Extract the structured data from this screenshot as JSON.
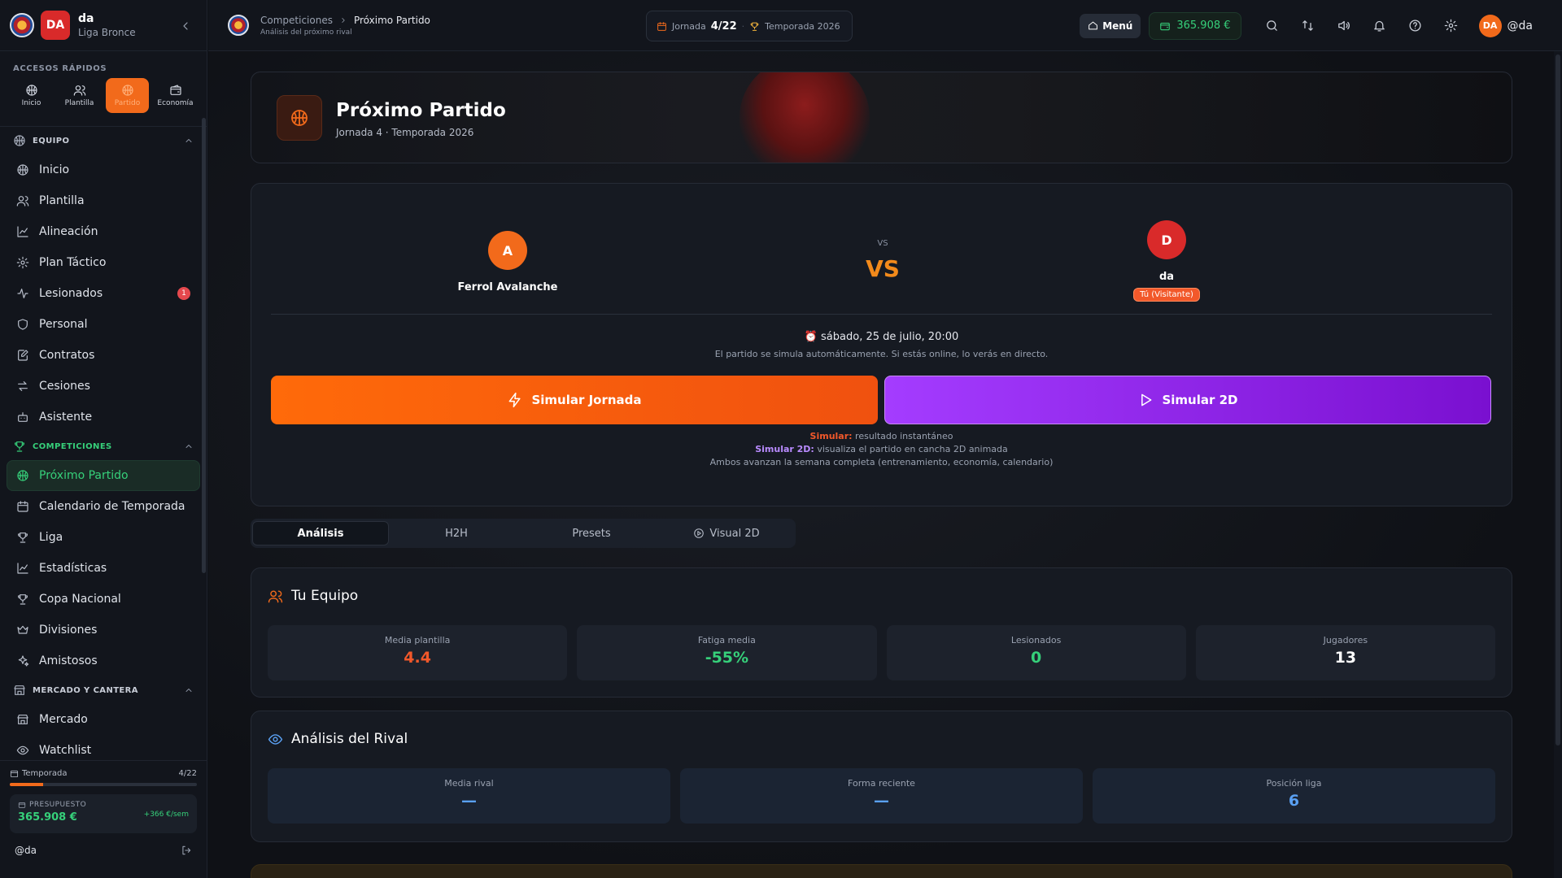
{
  "sidebar": {
    "club_badge": "DA",
    "club_name": "da",
    "club_league": "Liga Bronce",
    "quick_title": "Accesos rápidos",
    "quick": [
      {
        "label": "Inicio",
        "icon": "basketball-icon"
      },
      {
        "label": "Plantilla",
        "icon": "users-icon"
      },
      {
        "label": "Partido",
        "icon": "basketball-icon",
        "active": true
      },
      {
        "label": "Economía",
        "icon": "wallet-icon"
      }
    ],
    "groups": [
      {
        "title": "Equipo",
        "items": [
          "Inicio",
          "Plantilla",
          "Alineación",
          "Plan Táctico",
          "Lesionados",
          "Personal",
          "Contratos",
          "Cesiones",
          "Asistente"
        ],
        "badge": "1"
      },
      {
        "title": "Competiciones",
        "items": [
          "Próximo Partido",
          "Calendario de Temporada",
          "Liga",
          "Estadísticas",
          "Copa Nacional",
          "Divisiones",
          "Amistosos"
        ]
      },
      {
        "title": "Mercado y cantera",
        "items": [
          "Mercado",
          "Watchlist"
        ]
      }
    ],
    "season_label": "Temporada",
    "season_progress": "4/22",
    "season_fraction": 0.18,
    "budget_label": "Presupuesto",
    "budget_value": "365.908 €",
    "budget_delta": "+366 €/sem",
    "user": "@da"
  },
  "topbar": {
    "crumb_parent": "Competiciones",
    "crumb_current": "Próximo Partido",
    "crumb_sub": "Análisis del próximo rival",
    "jornada_label": "Jornada",
    "jornada_value": "4/22",
    "temporada": "Temporada 2026",
    "menu_label": "Menú",
    "money": "365.908 €",
    "avatar": "DA",
    "username": "@da"
  },
  "hero": {
    "title": "Próximo Partido",
    "subtitle": "Jornada 4 · Temporada 2026"
  },
  "match": {
    "home": {
      "initial": "A",
      "name": "Ferrol Avalanche"
    },
    "away": {
      "initial": "D",
      "name": "da",
      "tag": "Tú (Visitante)"
    },
    "vs_small": "VS",
    "vs_big": "VS",
    "date": "sábado, 25 de julio, 20:00",
    "note": "El partido se simula automáticamente. Si estás online, lo verás en directo.",
    "btn_simulate": "Simular Jornada",
    "btn_simulate_2d": "Simular 2D",
    "legend_sim_key": "Simular:",
    "legend_sim_text": " resultado instantáneo",
    "legend_2d_key": "Simular 2D:",
    "legend_2d_text": " visualiza el partido en cancha 2D animada",
    "legend_both": "Ambos avanzan la semana completa (entrenamiento, economía, calendario)"
  },
  "tabs": [
    "Análisis",
    "H2H",
    "Presets",
    "Visual 2D"
  ],
  "team_section": {
    "title": "Tu Equipo",
    "stats": [
      {
        "label": "Media plantilla",
        "value": "4.4",
        "color": "#f2582a"
      },
      {
        "label": "Fatiga media",
        "value": "-55%",
        "color": "#36d07a"
      },
      {
        "label": "Lesionados",
        "value": "0",
        "color": "#36d07a"
      },
      {
        "label": "Jugadores",
        "value": "13",
        "color": "#ffffff"
      }
    ]
  },
  "rival_section": {
    "title": "Análisis del Rival",
    "stats": [
      {
        "label": "Media rival",
        "value": "—",
        "color": "#5aa0f2"
      },
      {
        "label": "Forma reciente",
        "value": "—",
        "color": "#5aa0f2"
      },
      {
        "label": "Posición liga",
        "value": "6",
        "color": "#5aa0f2"
      }
    ]
  },
  "colors": {
    "accent": "#f26a1b",
    "green": "#36d07a",
    "purple": "#a43cff",
    "blue": "#5aa0f2"
  }
}
